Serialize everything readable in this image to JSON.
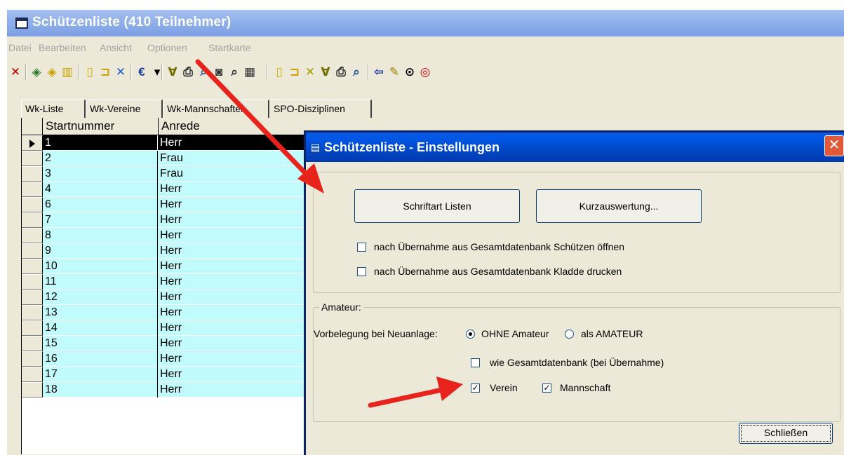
{
  "window": {
    "title": "Schützenliste (410 Teilnehmer)"
  },
  "menu": [
    "Datei",
    "Bearbeiten",
    "Ansicht",
    "Optionen",
    "Startkarte"
  ],
  "toolbar": {
    "icons": [
      {
        "name": "delete-icon",
        "glyph": "✕",
        "color": "#cc0000"
      },
      {
        "name": "open-book-icon",
        "glyph": "◈",
        "color": "#2b7a2b"
      },
      {
        "name": "book-icon",
        "glyph": "◈",
        "color": "#c8a000"
      },
      {
        "name": "books-icon",
        "glyph": "▥",
        "color": "#c8a000"
      },
      {
        "name": "new-document-icon",
        "glyph": "▯",
        "color": "#d4b000"
      },
      {
        "name": "open-folder-icon",
        "glyph": "⊐",
        "color": "#c8a000"
      },
      {
        "name": "cancel-icon",
        "glyph": "✕",
        "color": "#2060d0"
      },
      {
        "name": "euro-icon",
        "glyph": "€",
        "color": "#1a3aa0"
      },
      {
        "name": "dropdown-arrow-icon",
        "glyph": "▾",
        "color": "#000000"
      },
      {
        "name": "filter-icon",
        "glyph": "∀",
        "color": "#707000"
      },
      {
        "name": "print-icon",
        "glyph": "⎙",
        "color": "#303030"
      },
      {
        "name": "print-preview-icon",
        "glyph": "⌕",
        "color": "#2050a0"
      },
      {
        "name": "camera-icon",
        "glyph": "◙",
        "color": "#303030"
      },
      {
        "name": "preview-icon",
        "glyph": "⌕",
        "color": "#303030"
      },
      {
        "name": "table-icon",
        "glyph": "▦",
        "color": "#303030"
      },
      {
        "name": "new-document-icon-2",
        "glyph": "▯",
        "color": "#d4b000"
      },
      {
        "name": "open-folder-icon-2",
        "glyph": "⊐",
        "color": "#c8a000"
      },
      {
        "name": "cancel-icon-2",
        "glyph": "✕",
        "color": "#a0a000"
      },
      {
        "name": "filter-icon-2",
        "glyph": "∀",
        "color": "#707000"
      },
      {
        "name": "print-icon-2",
        "glyph": "⎙",
        "color": "#303030"
      },
      {
        "name": "print-preview-icon-2",
        "glyph": "⌕",
        "color": "#2050a0"
      },
      {
        "name": "back-arrow-icon",
        "glyph": "⇦",
        "color": "#1a3aa0"
      },
      {
        "name": "edit-icon",
        "glyph": "✎",
        "color": "#a08000"
      },
      {
        "name": "target-icon",
        "glyph": "⊙",
        "color": "#000000"
      },
      {
        "name": "target-red-icon",
        "glyph": "◎",
        "color": "#d00000"
      }
    ]
  },
  "tabs": [
    "Wk-Liste",
    "Wk-Vereine",
    "Wk-Mannschaften",
    "SPO-Disziplinen"
  ],
  "grid": {
    "columns": [
      "Startnummer",
      "Anrede"
    ],
    "rows": [
      {
        "nr": "1",
        "anrede": "Herr",
        "selected": true
      },
      {
        "nr": "2",
        "anrede": "Frau"
      },
      {
        "nr": "3",
        "anrede": "Frau"
      },
      {
        "nr": "4",
        "anrede": "Herr"
      },
      {
        "nr": "6",
        "anrede": "Herr"
      },
      {
        "nr": "7",
        "anrede": "Herr"
      },
      {
        "nr": "8",
        "anrede": "Herr"
      },
      {
        "nr": "9",
        "anrede": "Herr"
      },
      {
        "nr": "10",
        "anrede": "Herr"
      },
      {
        "nr": "11",
        "anrede": "Herr"
      },
      {
        "nr": "12",
        "anrede": "Herr"
      },
      {
        "nr": "13",
        "anrede": "Herr"
      },
      {
        "nr": "14",
        "anrede": "Herr"
      },
      {
        "nr": "15",
        "anrede": "Herr"
      },
      {
        "nr": "16",
        "anrede": "Herr"
      },
      {
        "nr": "17",
        "anrede": "Herr"
      },
      {
        "nr": "18",
        "anrede": "Herr"
      }
    ]
  },
  "dialog": {
    "title": "Schützenliste - Einstellungen",
    "close_label": "✕",
    "font_button": "Schriftart Listen",
    "summary_button": "Kurzauswertung...",
    "checkbox_open_label": "nach Übernahme aus Gesamtdatenbank Schützen öffnen",
    "checkbox_open_checked": false,
    "checkbox_print_label": "nach Übernahme aus Gesamtdatenbank Kladde drucken",
    "checkbox_print_checked": false,
    "amateur_group_label": "Amateur:",
    "preset_label": "Vorbelegung bei Neuanlage:",
    "radio_without_label": "OHNE Amateur",
    "radio_as_label": "als AMATEUR",
    "radio_selected": "without",
    "checkbox_like_db_label": "wie Gesamtdatenbank (bei Übernahme)",
    "checkbox_like_db_checked": false,
    "checkbox_club_label": "Verein",
    "checkbox_club_checked": true,
    "checkbox_team_label": "Mannschaft",
    "checkbox_team_checked": true,
    "close_button": "Schließen"
  },
  "colors": {
    "grid_row": "#c2fbfb",
    "dialog_title": "#0055e5",
    "annotation_arrow": "#e8231b"
  }
}
